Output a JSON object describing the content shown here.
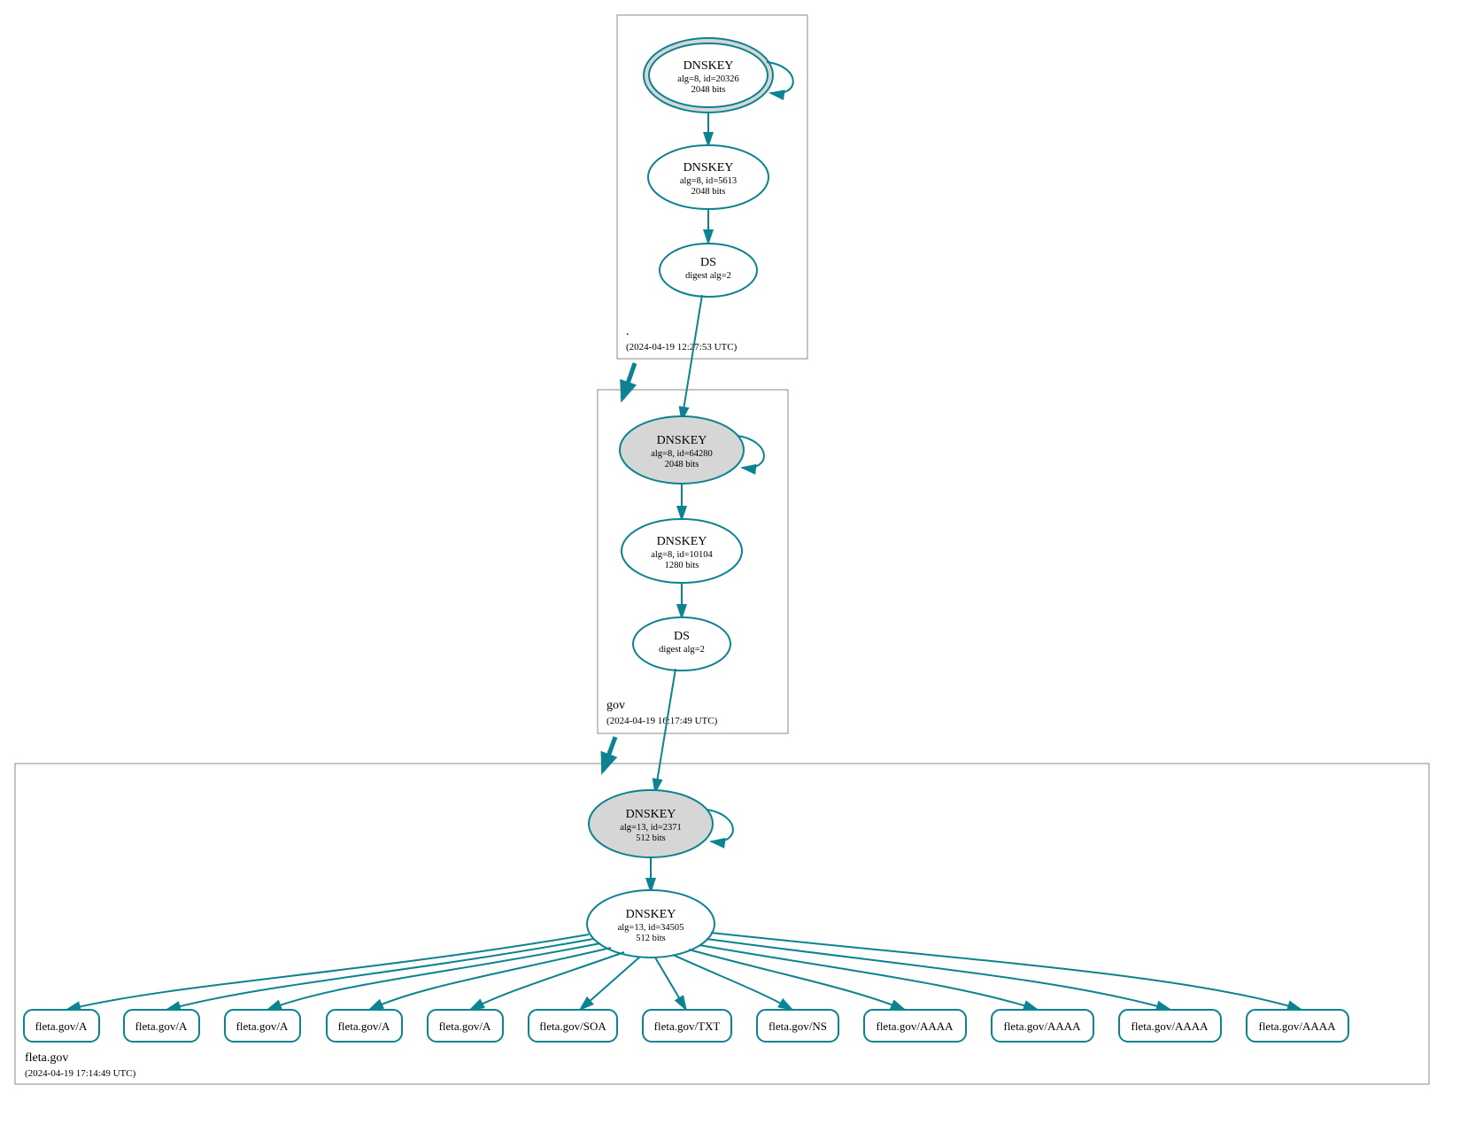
{
  "colors": {
    "accent": "#0b8390",
    "nodeFill": "#d6d6d6"
  },
  "zones": {
    "root": {
      "label": ".",
      "timestamp": "(2024-04-19 12:27:53 UTC)"
    },
    "gov": {
      "label": "gov",
      "timestamp": "(2024-04-19 16:17:49 UTC)"
    },
    "fleta": {
      "label": "fleta.gov",
      "timestamp": "(2024-04-19 17:14:49 UTC)"
    }
  },
  "nodes": {
    "rootKSK": {
      "title": "DNSKEY",
      "line1": "alg=8, id=20326",
      "line2": "2048 bits"
    },
    "rootZSK": {
      "title": "DNSKEY",
      "line1": "alg=8, id=5613",
      "line2": "2048 bits"
    },
    "rootDS": {
      "title": "DS",
      "line1": "digest alg=2",
      "line2": ""
    },
    "govKSK": {
      "title": "DNSKEY",
      "line1": "alg=8, id=64280",
      "line2": "2048 bits"
    },
    "govZSK": {
      "title": "DNSKEY",
      "line1": "alg=8, id=10104",
      "line2": "1280 bits"
    },
    "govDS": {
      "title": "DS",
      "line1": "digest alg=2",
      "line2": ""
    },
    "fletaKSK": {
      "title": "DNSKEY",
      "line1": "alg=13, id=2371",
      "line2": "512 bits"
    },
    "fletaZSK": {
      "title": "DNSKEY",
      "line1": "alg=13, id=34505",
      "line2": "512 bits"
    }
  },
  "leaves": {
    "l0": "fleta.gov/A",
    "l1": "fleta.gov/A",
    "l2": "fleta.gov/A",
    "l3": "fleta.gov/A",
    "l4": "fleta.gov/A",
    "l5": "fleta.gov/SOA",
    "l6": "fleta.gov/TXT",
    "l7": "fleta.gov/NS",
    "l8": "fleta.gov/AAAA",
    "l9": "fleta.gov/AAAA",
    "l10": "fleta.gov/AAAA",
    "l11": "fleta.gov/AAAA"
  }
}
